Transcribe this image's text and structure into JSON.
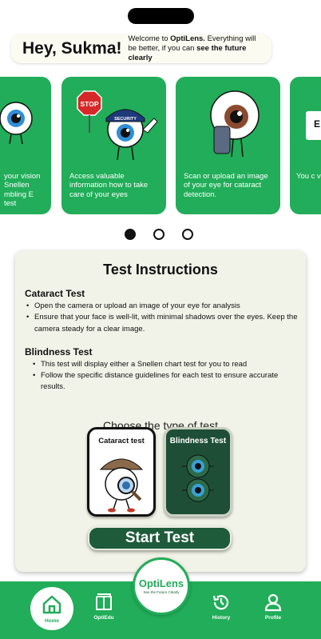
{
  "greeting": {
    "hey_prefix": "Hey,",
    "name": "Sukma!",
    "welcome_text": "Welcome to",
    "brand": "OptiLens.",
    "welcome_mid": "Everything will be better, if you can",
    "welcome_emph": "see the future clearly"
  },
  "carousel": {
    "cards": [
      {
        "text": "your vision Snellen mbling E test"
      },
      {
        "text": "Access valuable information how to take care of your eyes"
      },
      {
        "text": "Scan or upload an image of your eye for cataract detection."
      },
      {
        "text": "You c visio Snelle Tumbl"
      }
    ],
    "stop_sign": "STOP",
    "security_cap": "SECURITY",
    "active_index": 0,
    "dot_count": 3
  },
  "instructions": {
    "title": "Test Instructions",
    "cataract": {
      "title": "Cataract Test",
      "items": [
        "Open the camera or upload an image of your eye for analysis",
        "Ensure that your face is well-lit, with minimal shadows over the eyes. Keep the camera steady for a clear image."
      ]
    },
    "blindness": {
      "title": "Blindness Test",
      "items": [
        "This test will display either a Snellen chart test for you to read",
        "Follow the specific distance guidelines for each test to ensure accurate results."
      ]
    },
    "choose_label": "Choose the type of test",
    "tests": [
      {
        "label": "Cataract test"
      },
      {
        "label": "Blindness Test"
      }
    ],
    "start_label": "Start Test"
  },
  "brand": {
    "name": "OptiLens",
    "tagline": "See the Future Clearly"
  },
  "nav": {
    "home": "Home",
    "optiedu": "OptiEdu",
    "history": "History",
    "profile": "Profile"
  },
  "colors": {
    "brand_green": "#21ad59",
    "dark_green": "#1e5b3a",
    "panel_bg": "#f2f3e8"
  }
}
